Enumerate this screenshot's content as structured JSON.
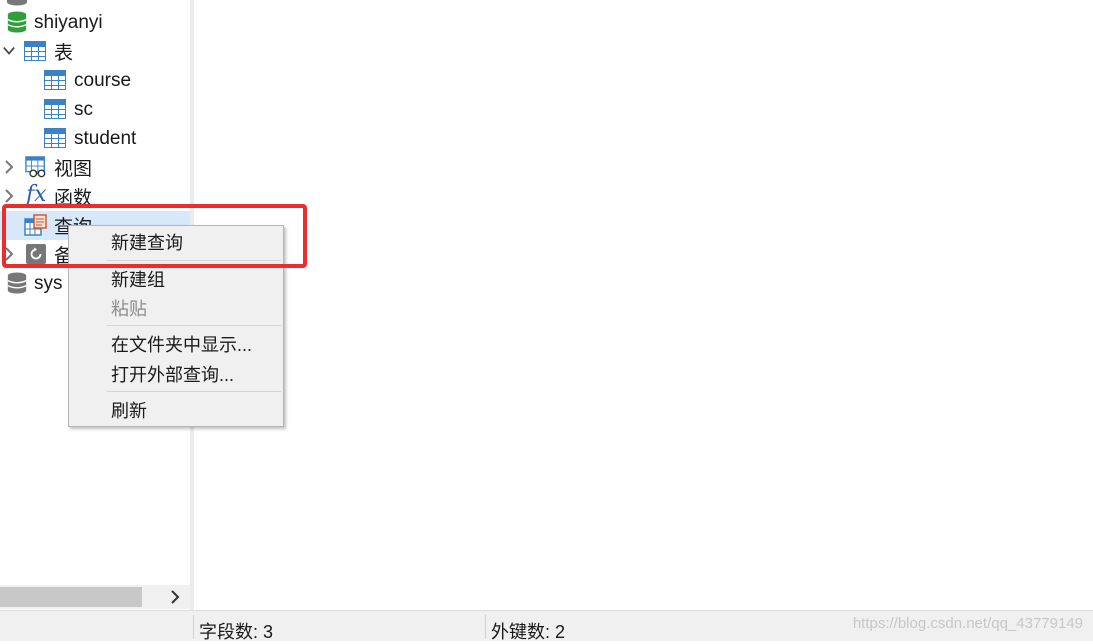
{
  "tree": {
    "db_shiyanyi": "shiyanyi",
    "node_tables": "表",
    "table_course": "course",
    "table_sc": "sc",
    "table_student": "student",
    "node_views": "视图",
    "node_functions": "函数",
    "node_queries": "查询",
    "node_backup": "备",
    "db_sys": "sys"
  },
  "context_menu": {
    "new_query": "新建查询",
    "new_group": "新建组",
    "paste": "粘贴",
    "show_in_folder": "在文件夹中显示...",
    "open_external_query": "打开外部查询...",
    "refresh": "刷新"
  },
  "statusbar": {
    "field_count": "字段数: 3",
    "foreign_key_count": "外键数: 2",
    "watermark": "https://blog.csdn.net/qq_43779149"
  },
  "icons": {
    "database_active": "database-green-icon",
    "database_inactive": "database-gray-icon",
    "table": "table-icon",
    "view": "view-icon",
    "function": "function-fx-icon",
    "query": "query-icon",
    "backup": "backup-icon"
  },
  "colors": {
    "highlight_border": "#ec2d2d",
    "selection": "#d8e8fb",
    "table_icon": "#3b82c4",
    "db_active": "#2f9e3b"
  }
}
